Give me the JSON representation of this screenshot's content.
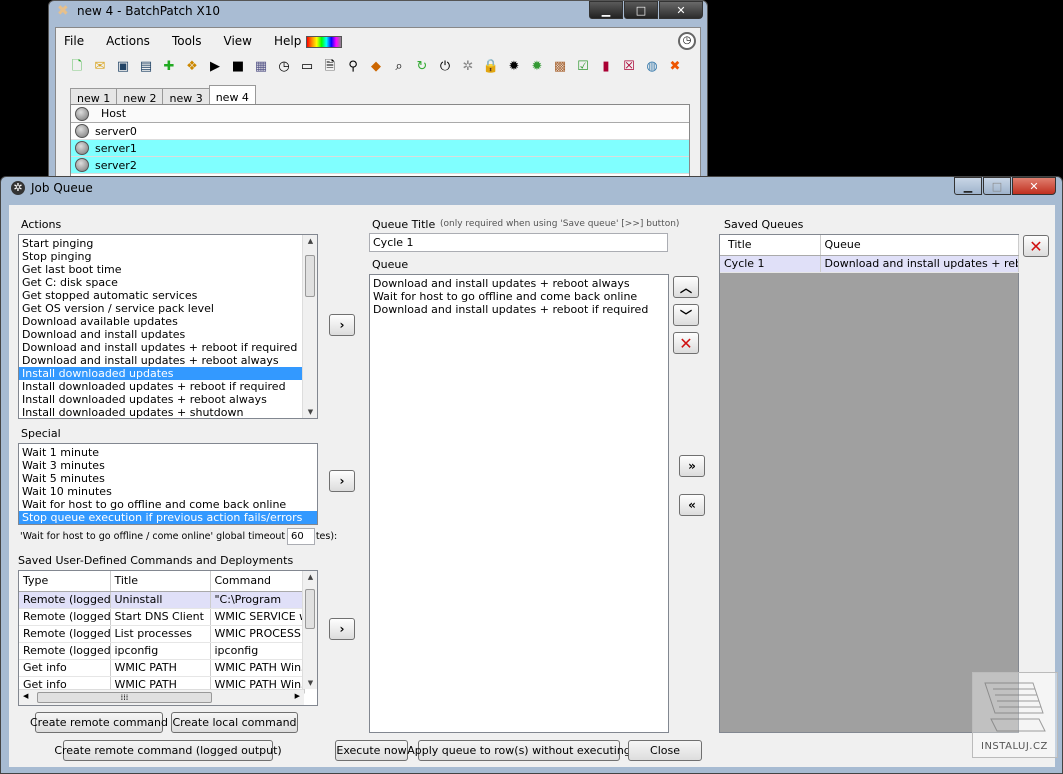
{
  "main_window": {
    "title": "new 4 - BatchPatch X10",
    "menu": [
      "File",
      "Actions",
      "Tools",
      "View",
      "Help"
    ],
    "tabs": [
      "new 1",
      "new 2",
      "new 3",
      "new 4"
    ],
    "active_tab": "new 4",
    "grid_header": "Host",
    "hosts": [
      "server0",
      "server1",
      "server2"
    ]
  },
  "dialog": {
    "title": "Job Queue",
    "actions_label": "Actions",
    "actions": [
      "Start pinging",
      "Stop pinging",
      "Get last boot time",
      "Get C: disk space",
      "Get stopped automatic services",
      "Get OS version / service pack level",
      "Download available updates",
      "Download and install updates",
      "Download and install updates + reboot if required",
      "Download and install updates + reboot always",
      "Install downloaded updates",
      "Install downloaded updates + reboot if required",
      "Install downloaded updates + reboot always",
      "Install downloaded updates + shutdown"
    ],
    "actions_selected_index": 10,
    "special_label": "Special",
    "special": [
      "Wait 1 minute",
      "Wait 3 minutes",
      "Wait 5 minutes",
      "Wait 10 minutes",
      "Wait for host to go offline and come back online",
      "Stop queue execution if previous action fails/errors"
    ],
    "timeout_label": "'Wait for host to go offline / come online' global timeout (minutes):",
    "timeout_value": "60",
    "saved_cmds_label": "Saved User-Defined Commands and Deployments",
    "saved_cmds_columns": [
      "Type",
      "Title",
      "Command"
    ],
    "saved_cmds_rows": [
      [
        "Remote (logged)",
        "Uninstall",
        "\"C:\\Program"
      ],
      [
        "Remote (logged)",
        "Start DNS Client",
        "WMIC SERVICE w"
      ],
      [
        "Remote (logged)",
        "List processes",
        "WMIC PROCESS"
      ],
      [
        "Remote (logged)",
        "ipconfig",
        "ipconfig"
      ],
      [
        "Get info",
        "WMIC PATH",
        "WMIC PATH Win3"
      ],
      [
        "Get info",
        "WMIC PATH",
        "WMIC PATH Win3"
      ]
    ],
    "btn_create_remote": "Create remote command",
    "btn_create_local": "Create local command",
    "btn_create_remote_logged": "Create remote command (logged output)",
    "queue_title_label": "Queue Title",
    "queue_title_hint": "(only required when using 'Save queue' [>>] button)",
    "queue_title_value": "Cycle 1",
    "queue_label": "Queue",
    "queue_items": [
      "Download and install updates + reboot always",
      "Wait for host to go offline and come back online",
      "Download and install updates + reboot if required"
    ],
    "saved_queues_label": "Saved Queues",
    "saved_queues_columns": [
      "Title",
      "Queue"
    ],
    "saved_queues_rows": [
      [
        "Cycle 1",
        "Download and install updates + reboo…"
      ]
    ],
    "btn_execute": "Execute now",
    "btn_apply": "Apply queue to row(s) without executing",
    "btn_close": "Close",
    "watermark": "INSTALUJ.CZ"
  }
}
